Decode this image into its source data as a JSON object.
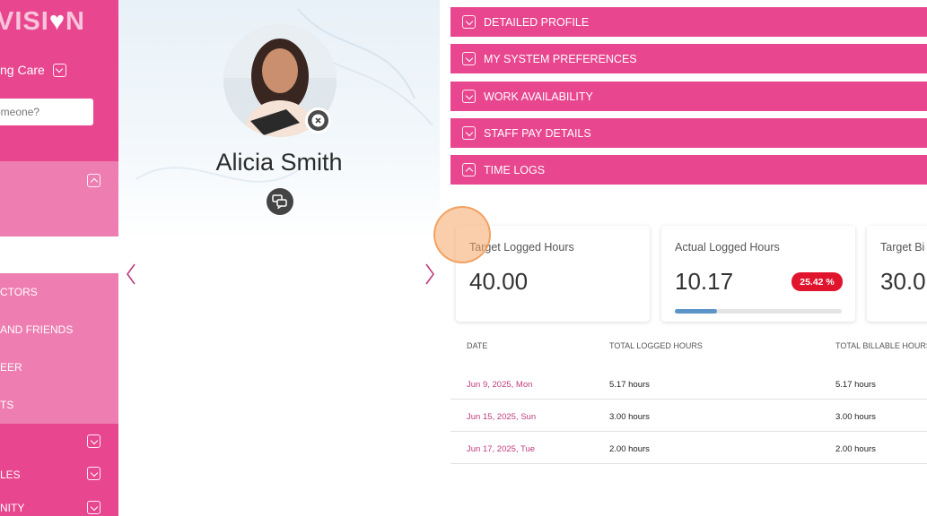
{
  "sidebar": {
    "logo_left": "VISI",
    "logo_right": "N",
    "org_label": "ng Care",
    "search_placeholder": "omeone?",
    "items": [
      {
        "label": "CTORS"
      },
      {
        "label": "AND FRIENDS"
      },
      {
        "label": "EER"
      },
      {
        "label": "TS"
      },
      {
        "label": "LES"
      },
      {
        "label": "NITY"
      }
    ]
  },
  "profile": {
    "name": "Alicia Smith"
  },
  "accordion": [
    {
      "label": "DETAILED PROFILE",
      "expanded": false
    },
    {
      "label": "MY SYSTEM PREFERENCES",
      "expanded": false
    },
    {
      "label": "WORK AVAILABILITY",
      "expanded": false
    },
    {
      "label": "STAFF PAY DETAILS",
      "expanded": false
    },
    {
      "label": "TIME LOGS",
      "expanded": true
    }
  ],
  "cards": [
    {
      "title": "Target Logged Hours",
      "value": "40.00"
    },
    {
      "title": "Actual Logged Hours",
      "value": "10.17",
      "badge": "25.42 %",
      "progress": 0.2542
    },
    {
      "title": "Target Bi",
      "value": "30.0"
    }
  ],
  "table": {
    "headers": [
      "DATE",
      "TOTAL LOGGED HOURS",
      "TOTAL BILLABLE HOURS"
    ],
    "rows": [
      {
        "date": "Jun 9, 2025, Mon",
        "logged": "5.17 hours",
        "billable": "5.17 hours"
      },
      {
        "date": "Jun 15, 2025, Sun",
        "logged": "3.00 hours",
        "billable": "3.00 hours"
      },
      {
        "date": "Jun 17, 2025, Tue",
        "logged": "2.00 hours",
        "billable": "2.00 hours"
      }
    ]
  },
  "colors": {
    "brand_pink": "#e8468f",
    "panel_pink": "#ee7db1",
    "badge_red": "#e0142c",
    "progress_blue": "#5b95c8",
    "date_link": "#c23a7d"
  },
  "icons": {
    "avatar_remove": "close-circle-icon",
    "chat": "chat-bubbles-icon",
    "prev": "chevron-left-icon",
    "next": "chevron-right-icon",
    "accordion_toggle": "chevron-box-icon"
  }
}
